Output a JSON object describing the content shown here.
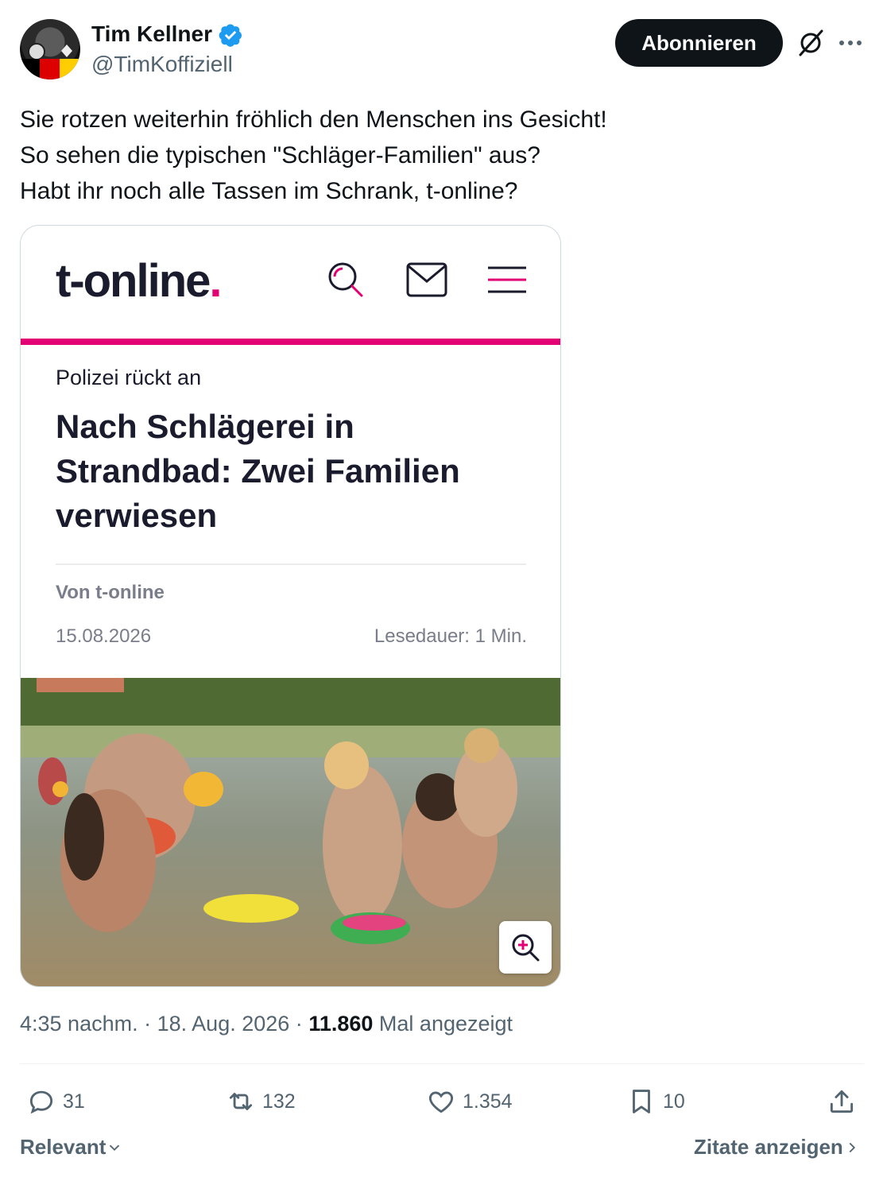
{
  "author": {
    "name": "Tim Kellner",
    "handle": "@TimKoffiziell",
    "verified_color": "#1d9bf0"
  },
  "header": {
    "follow_label": "Abonnieren",
    "icons": [
      "grok-icon",
      "more-icon"
    ]
  },
  "tweet": {
    "text": "Sie rotzen weiterhin fröhlich den Menschen ins Gesicht!\nSo sehen die typischen \"Schläger-Familien\" aus?\nHabt ihr noch alle Tassen im Schrank, t-online?"
  },
  "embed": {
    "logo_text": "t-online",
    "logo_dot": ".",
    "brand_color": "#e20074",
    "kicker": "Polizei rückt an",
    "headline": "Nach Schlägerei in Strandbad: Zwei Familien verwiesen",
    "author": "Von t-online",
    "date": "15.08.2026",
    "read_time": "Lesedauer: 1 Min.",
    "icons": [
      "search-icon",
      "mail-icon",
      "menu-icon",
      "zoom-in-icon"
    ]
  },
  "meta": {
    "time": "4:35 nachm.",
    "separator": "·",
    "date": "18. Aug. 2026",
    "views": "11.860",
    "views_label": "Mal angezeigt"
  },
  "actions": {
    "replies": "31",
    "reposts": "132",
    "likes": "1.354",
    "bookmarks": "10"
  },
  "footer": {
    "sort_label": "Relevant",
    "quotes_label": "Zitate anzeigen"
  }
}
